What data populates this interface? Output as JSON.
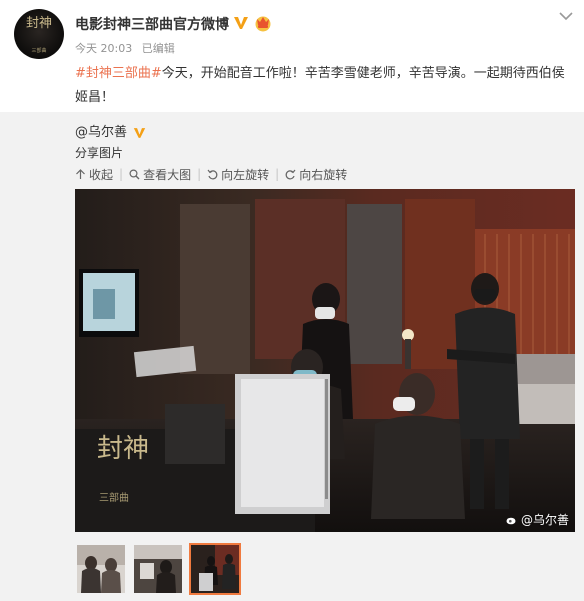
{
  "post": {
    "author": "电影封神三部曲官方微博",
    "time": "今天 20:03",
    "edited": "已编辑",
    "hashtag": "#封神三部曲#",
    "text": "今天，开始配音工作啦！辛苦李雪健老师，辛苦导演。一起期待西伯侯姬昌！",
    "avatar_logo": "封神",
    "avatar_logo_sub": "三部曲"
  },
  "repost": {
    "author": "@乌尔善",
    "share_label": "分享图片",
    "actions": [
      "收起",
      "查看大图",
      "向左旋转",
      "向右旋转"
    ],
    "watermark": "@乌尔善",
    "photo_logo": "封神",
    "photo_logo_sub": "三部曲"
  },
  "icons": [
    "verified-icon",
    "vip-icon",
    "chevron-down-icon",
    "collapse-icon",
    "search-icon",
    "rotate-left-icon",
    "rotate-right-icon",
    "weibo-icon"
  ],
  "colors": {
    "hashtag": "#eb7350",
    "verified": "#f4a016",
    "thumb_active": "#f07a3f",
    "repost_bg": "#f2f2f2"
  }
}
